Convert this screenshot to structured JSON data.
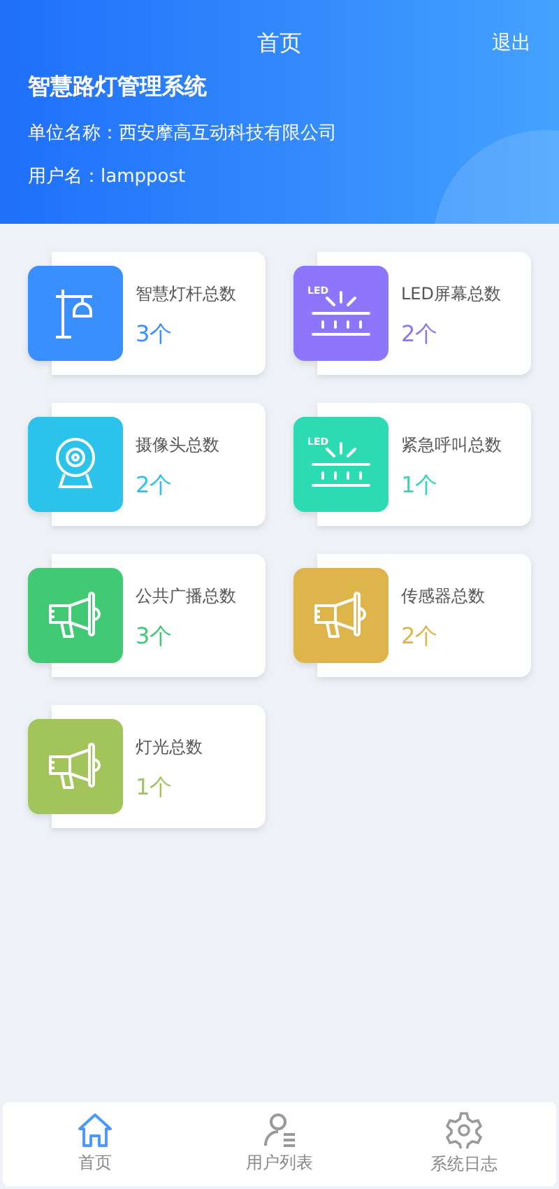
{
  "header": {
    "title": "首页",
    "logout": "退出",
    "system_name": "智慧路灯管理系统",
    "unit": "单位名称：西安摩高互动科技有限公司",
    "user": "用户名：lamppost"
  },
  "cards": [
    {
      "kind": "pole",
      "label": "智慧灯杆总数",
      "count": "3个",
      "color": "#3a8ffe"
    },
    {
      "kind": "led",
      "icon_text": "LED",
      "label": "LED屏幕总数",
      "count": "2个",
      "color": "#8d76fb"
    },
    {
      "kind": "camera",
      "label": "摄像头总数",
      "count": "2个",
      "color": "#2cc3ea"
    },
    {
      "kind": "led",
      "icon_text": "LED",
      "label": "紧急呼叫总数",
      "count": "1个",
      "color": "#2cdbb2"
    },
    {
      "kind": "speaker",
      "label": "公共广播总数",
      "count": "3个",
      "color": "#41c974"
    },
    {
      "kind": "speaker",
      "label": "传感器总数",
      "count": "2个",
      "color": "#deb54a"
    },
    {
      "kind": "speaker",
      "label": "灯光总数",
      "count": "1个",
      "color": "#a2c45a"
    }
  ],
  "tabbar": [
    {
      "kind": "home",
      "label": "首页",
      "selected": true
    },
    {
      "kind": "user-list",
      "label": "用户列表",
      "selected": false
    },
    {
      "kind": "gear",
      "label": "系统日志",
      "selected": false
    }
  ]
}
